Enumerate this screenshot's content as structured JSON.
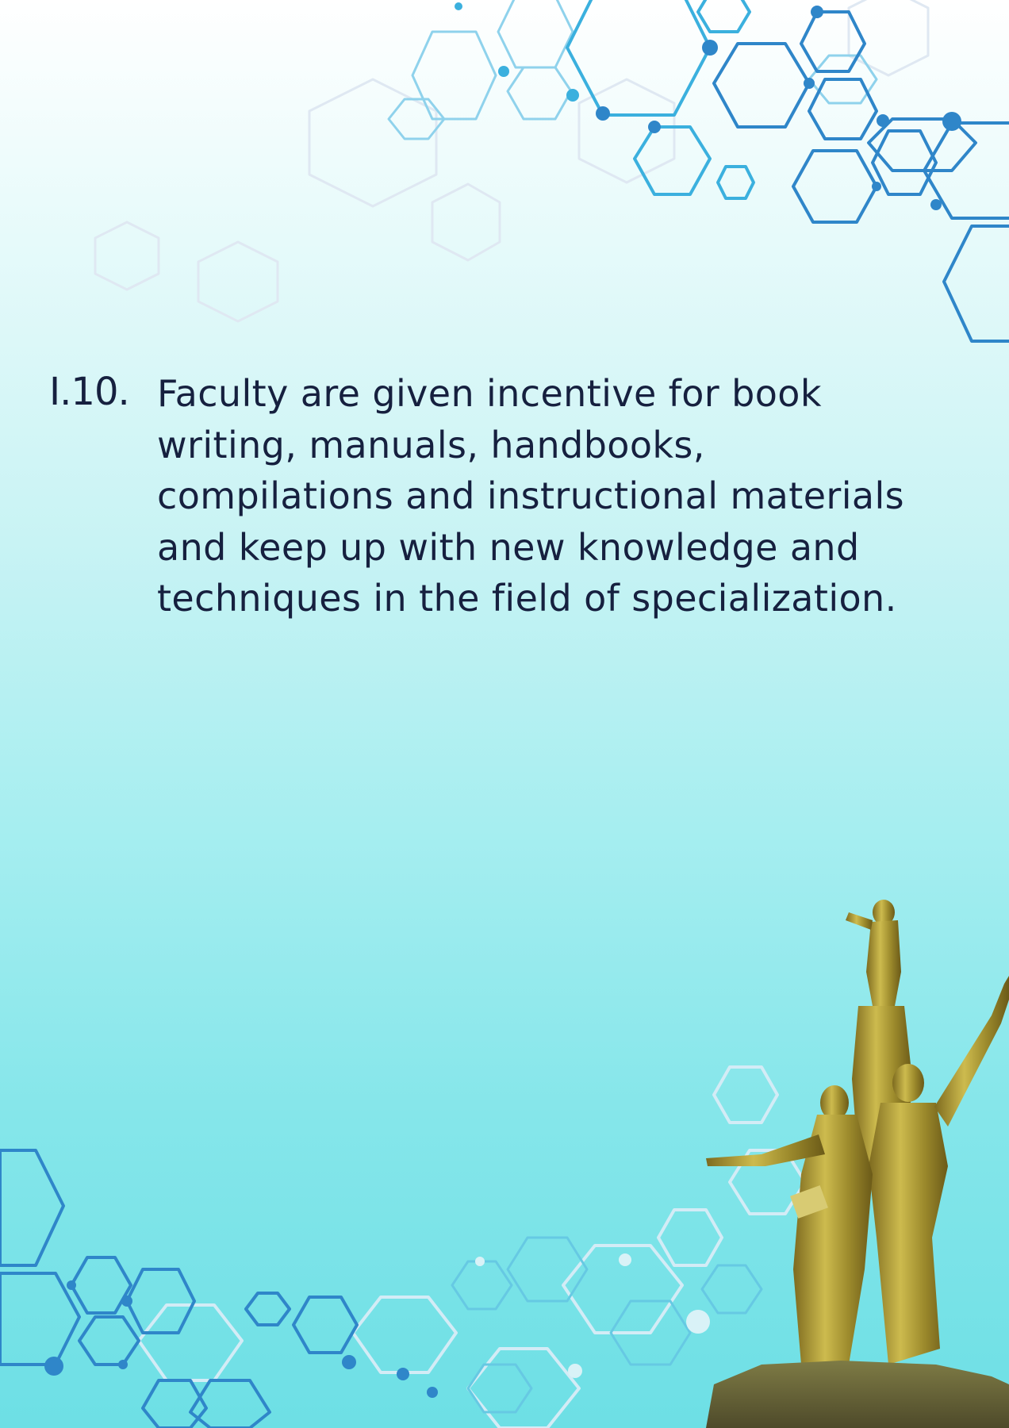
{
  "item": {
    "number": "I.10.",
    "text_lines": [
      "Faculty are given incentive for book",
      "writing, manuals, handbooks,",
      "compilations and instructional materials",
      "and keep up with new knowledge and",
      "techniques in the field of specialization."
    ]
  },
  "decor": {
    "hex_dark": "#2f86c9",
    "hex_mid": "#3bb0de",
    "hex_light": "#bfe6f4",
    "statue_gold": "#b9a53a",
    "text_color": "#16203f"
  }
}
